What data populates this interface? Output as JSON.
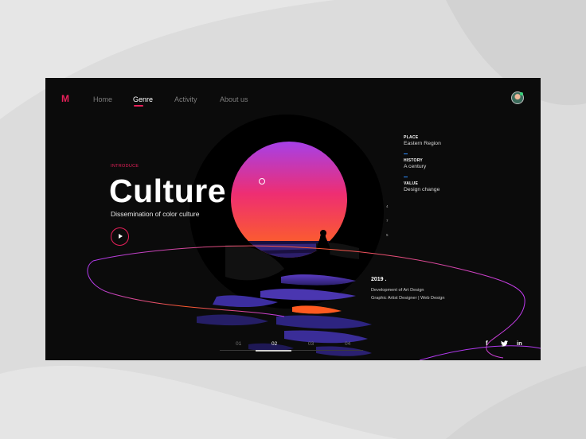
{
  "brand": {
    "logo": "M"
  },
  "nav": {
    "items": [
      {
        "label": "Home",
        "active": false
      },
      {
        "label": "Genre",
        "active": true
      },
      {
        "label": "Activity",
        "active": false
      },
      {
        "label": "About us",
        "active": false
      }
    ]
  },
  "hero": {
    "eyebrow": "INTRODUCE",
    "title": "Culture",
    "subtitle": "Dissemination of color culture"
  },
  "info": [
    {
      "label": "PLACE",
      "value": "Eastern Region"
    },
    {
      "label": "HISTORY",
      "value": "A century"
    },
    {
      "label": "VALUE",
      "value": "Design change"
    }
  ],
  "side_index": [
    "4",
    "7",
    "5"
  ],
  "work": {
    "year": "2019 .",
    "line1": "Development of Art Design",
    "line2": "Graphic Artist Designer  |  Web Design"
  },
  "pager": [
    "01",
    "02",
    "03",
    "04"
  ],
  "pager_active": "02",
  "social": {
    "facebook": "f",
    "twitter": "t",
    "linkedin": "in"
  },
  "colors": {
    "accent": "#e8205a",
    "info_dash": "#2d8dff",
    "background": "#0b0b0b"
  }
}
